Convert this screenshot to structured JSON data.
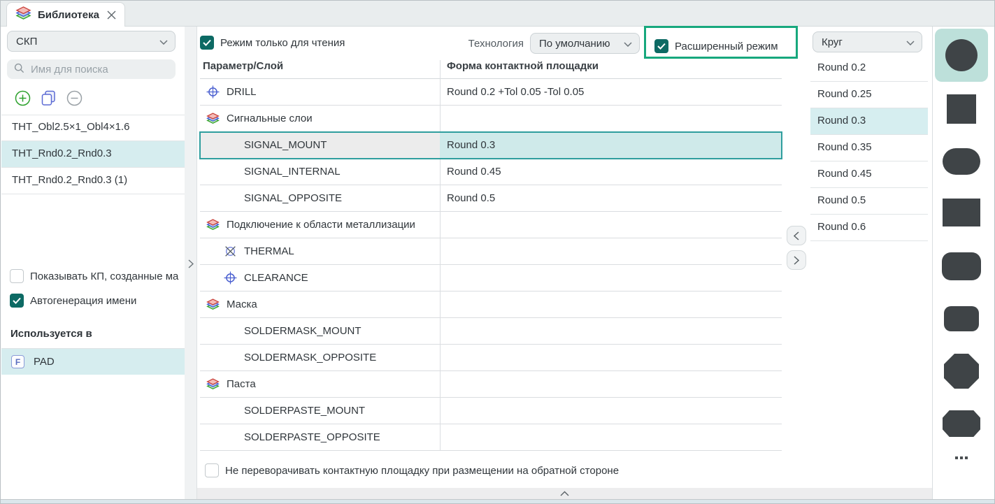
{
  "window": {
    "tab_title": "Библиотека"
  },
  "left_panel": {
    "library_type_select": {
      "value": "СКП"
    },
    "search": {
      "placeholder": "Имя для поиска"
    },
    "items": [
      {
        "label": "THT_Obl2.5×1_Obl4×1.6",
        "selected": false
      },
      {
        "label": "THT_Rnd0.2_Rnd0.3",
        "selected": true
      },
      {
        "label": "THT_Rnd0.2_Rnd0.3 (1)",
        "selected": false
      }
    ],
    "show_generated_checkbox": {
      "label": "Показывать КП, созданные ма",
      "checked": false
    },
    "autogen_checkbox": {
      "label": "Автогенерация имени",
      "checked": true
    },
    "used_in_header": "Используется в",
    "used_in_items": [
      {
        "badge": "F",
        "label": "PAD",
        "selected": true
      }
    ]
  },
  "toolbar": {
    "readonly_checkbox": {
      "label": "Режим только для чтения",
      "checked": true
    },
    "technology_label": "Технология",
    "technology_select": {
      "value": "По умолчанию"
    },
    "advanced_checkbox": {
      "label": "Расширенный режим",
      "checked": true,
      "highlighted": true
    }
  },
  "table": {
    "columns": [
      "Параметр/Слой",
      "Форма контактной площадки"
    ],
    "rows": [
      {
        "icon": "drill",
        "indent": 0,
        "label": "DRILL",
        "value": "Round 0.2  +Tol 0.05 -Tol 0.05",
        "selected": false
      },
      {
        "icon": "layers",
        "indent": 0,
        "label": "Сигнальные слои",
        "value": "",
        "selected": false
      },
      {
        "icon": null,
        "indent": 2,
        "label": "SIGNAL_MOUNT",
        "value": "Round 0.3",
        "selected": true
      },
      {
        "icon": null,
        "indent": 2,
        "label": "SIGNAL_INTERNAL",
        "value": "Round 0.45",
        "selected": false
      },
      {
        "icon": null,
        "indent": 2,
        "label": "SIGNAL_OPPOSITE",
        "value": "Round 0.5",
        "selected": false
      },
      {
        "icon": "layers",
        "indent": 0,
        "label": "Подключение к области металлизации",
        "value": "",
        "selected": false
      },
      {
        "icon": "thermal",
        "indent": 1,
        "label": "THERMAL",
        "value": "",
        "selected": false
      },
      {
        "icon": "drill",
        "indent": 1,
        "label": "CLEARANCE",
        "value": "",
        "selected": false
      },
      {
        "icon": "layers",
        "indent": 0,
        "label": "Маска",
        "value": "",
        "selected": false
      },
      {
        "icon": null,
        "indent": 2,
        "label": "SOLDERMASK_MOUNT",
        "value": "",
        "selected": false
      },
      {
        "icon": null,
        "indent": 2,
        "label": "SOLDERMASK_OPPOSITE",
        "value": "",
        "selected": false
      },
      {
        "icon": "layers",
        "indent": 0,
        "label": "Паста",
        "value": "",
        "selected": false
      },
      {
        "icon": null,
        "indent": 2,
        "label": "SOLDERPASTE_MOUNT",
        "value": "",
        "selected": false
      },
      {
        "icon": null,
        "indent": 2,
        "label": "SOLDERPASTE_OPPOSITE",
        "value": "",
        "selected": false
      }
    ]
  },
  "footer": {
    "no_flip_checkbox": {
      "label": "Не переворачивать контактную площадку при размещении на обратной стороне",
      "checked": false
    }
  },
  "right_panel": {
    "shape_select": {
      "value": "Круг"
    },
    "options": [
      {
        "label": "Round 0.2",
        "selected": false
      },
      {
        "label": "Round 0.25",
        "selected": false
      },
      {
        "label": "Round 0.3",
        "selected": true
      },
      {
        "label": "Round 0.35",
        "selected": false
      },
      {
        "label": "Round 0.45",
        "selected": false
      },
      {
        "label": "Round 0.5",
        "selected": false
      },
      {
        "label": "Round 0.6",
        "selected": false
      }
    ]
  },
  "shape_palette": {
    "shapes": [
      {
        "name": "circle",
        "selected": true
      },
      {
        "name": "square",
        "selected": false
      },
      {
        "name": "oblong",
        "selected": false
      },
      {
        "name": "rectangle",
        "selected": false
      },
      {
        "name": "rounded-rectangle-large",
        "selected": false
      },
      {
        "name": "rounded-rectangle",
        "selected": false
      },
      {
        "name": "octagon",
        "selected": false
      },
      {
        "name": "chamfered-rectangle",
        "selected": false
      }
    ]
  },
  "colors": {
    "accent_teal": "#0d6a64",
    "highlight_green": "#17a87d",
    "selection_cyan": "#d6eef0",
    "selection_border": "#2f9e9e"
  }
}
